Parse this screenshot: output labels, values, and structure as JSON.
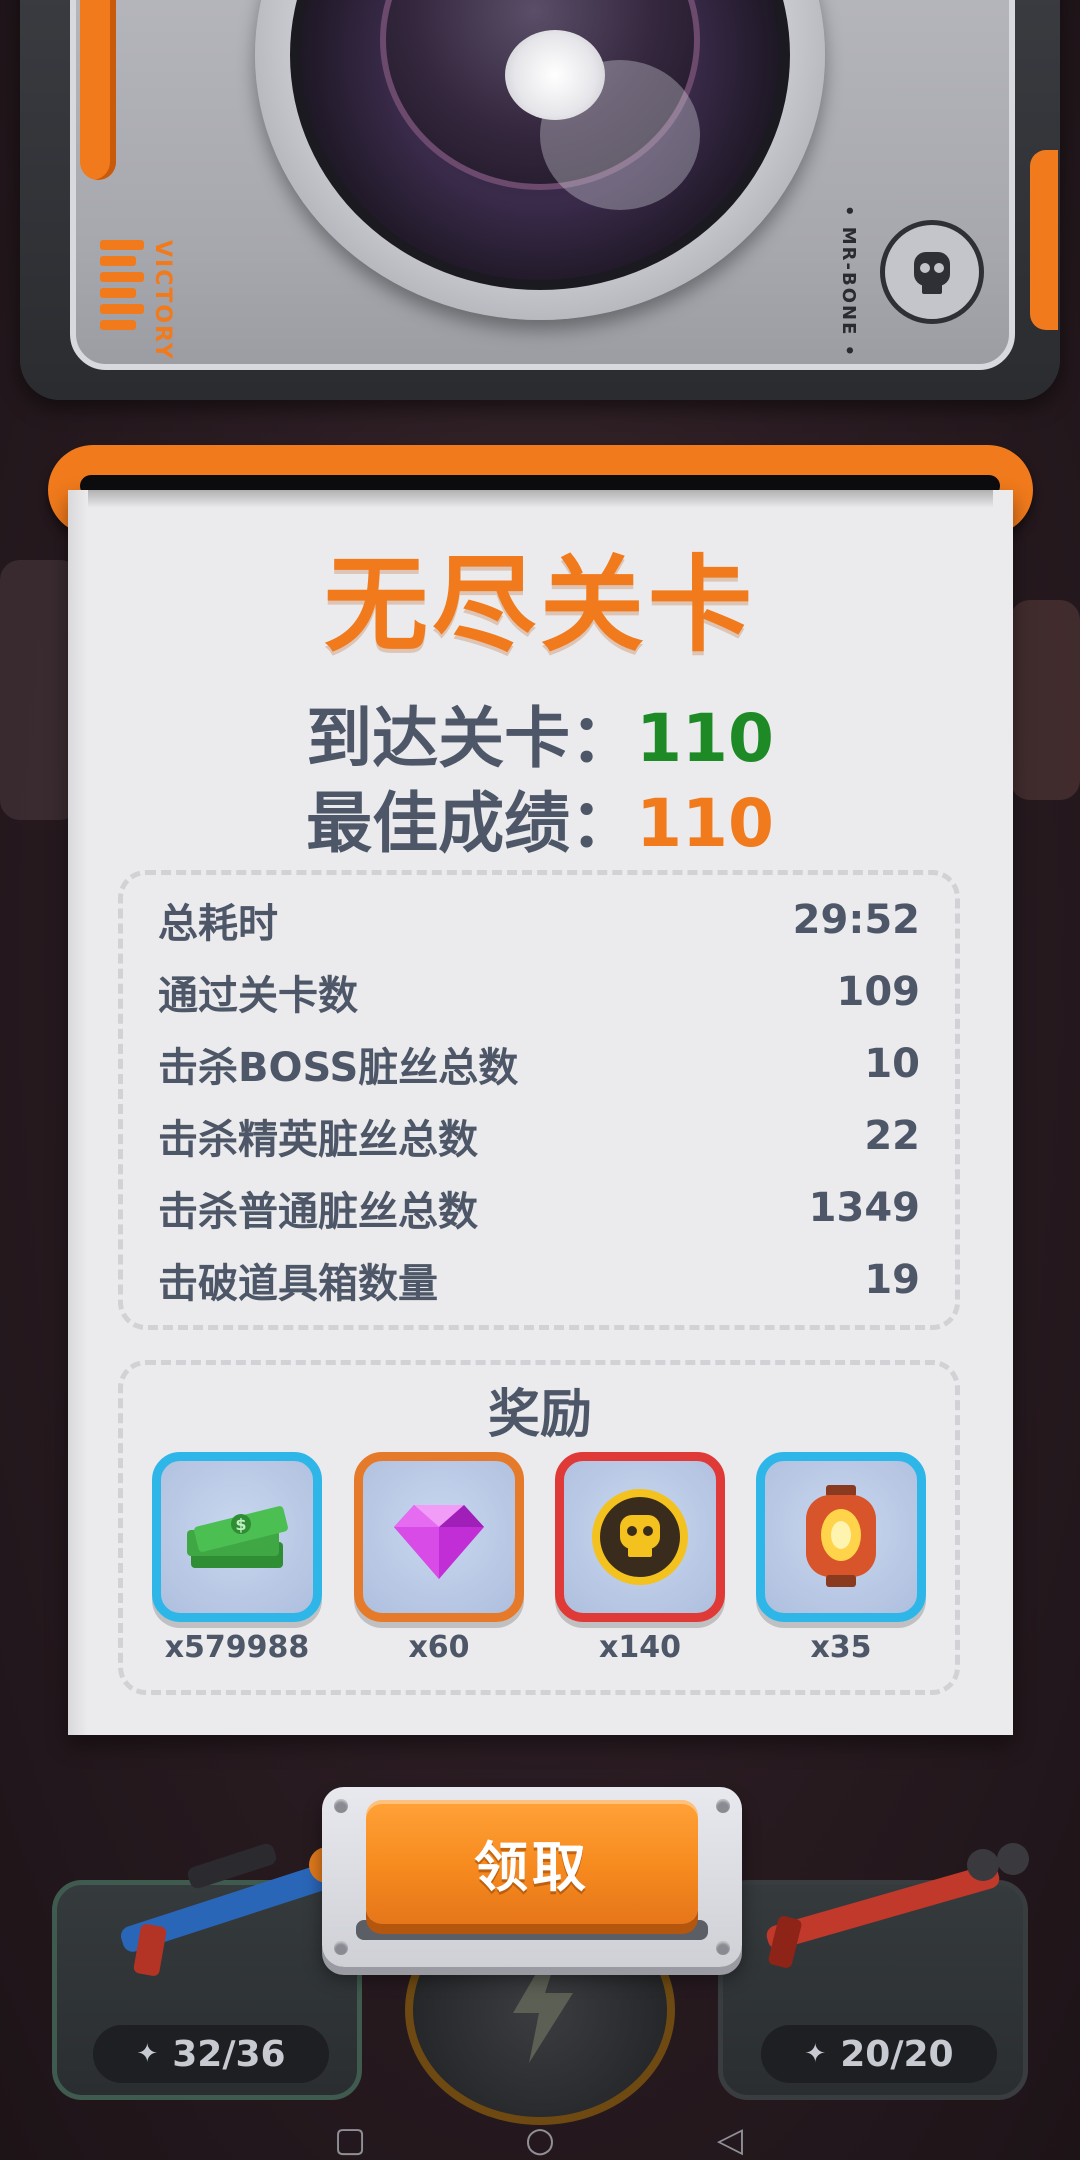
{
  "camera": {
    "logo_text": "VICTORY",
    "brand_text": "• MR-BONE •"
  },
  "receipt": {
    "title": "无尽关卡",
    "reached_label": "到达关卡：",
    "reached_value": "110",
    "best_label": "最佳成绩：",
    "best_value": "110",
    "details": [
      {
        "label": "总耗时",
        "value": "29:52"
      },
      {
        "label": "通过关卡数",
        "value": "109"
      },
      {
        "label": "击杀BOSS脏丝总数",
        "value": "10"
      },
      {
        "label": "击杀精英脏丝总数",
        "value": "22"
      },
      {
        "label": "击杀普通脏丝总数",
        "value": "1349"
      },
      {
        "label": "击破道具箱数量",
        "value": "19"
      }
    ],
    "rewards_title": "奖励",
    "rewards": [
      {
        "icon": "cash-stack-icon",
        "count": "x579988",
        "border": "#2fb6e8"
      },
      {
        "icon": "purple-gem-icon",
        "count": "x60",
        "border": "#e57a2a"
      },
      {
        "icon": "skull-coin-icon",
        "count": "x140",
        "border": "#e03a38"
      },
      {
        "icon": "lantern-icon",
        "count": "x35",
        "border": "#2fb6e8"
      }
    ]
  },
  "claim_button": {
    "label": "领取"
  },
  "weapons": {
    "left_ammo": "32/36",
    "right_ammo": "20/20"
  },
  "colors": {
    "accent_orange": "#f07a1c",
    "value_green": "#1e8a26",
    "text_slate": "#4e5768"
  }
}
